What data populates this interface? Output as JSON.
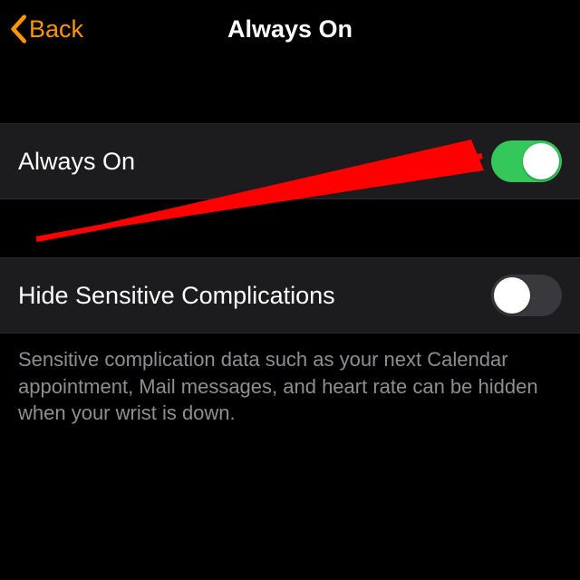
{
  "nav": {
    "back_label": "Back",
    "title": "Always On"
  },
  "rows": {
    "always_on_label": "Always On",
    "hide_sensitive_label": "Hide Sensitive Complications"
  },
  "footer": {
    "text": "Sensitive complication data such as your next Calendar appointment, Mail messages, and heart rate can be hidden when your wrist is down."
  },
  "colors": {
    "accent": "#ff9500",
    "toggle_on": "#34c759",
    "annotation": "#ff0000"
  },
  "states": {
    "always_on": true,
    "hide_sensitive": false
  }
}
